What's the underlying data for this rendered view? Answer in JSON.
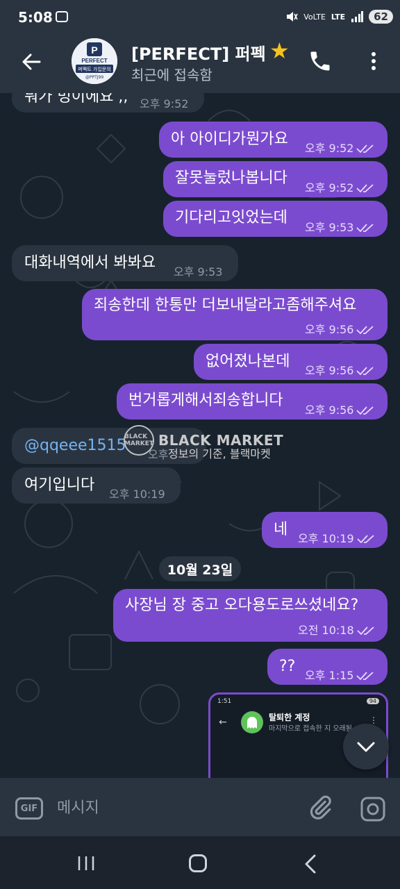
{
  "status_bar": {
    "time": "5:08",
    "battery": "62",
    "network": "LTE"
  },
  "header": {
    "title": "[PERFECT] 퍼펙",
    "subtitle": "최근에 접속함",
    "avatar_text": "PERFECT",
    "avatar_sub": "퍼펙트 가입문의",
    "avatar_handle": "@PPTJ99"
  },
  "messages": [
    {
      "dir": "in",
      "text": "뭐가 멍이에요 ,,",
      "time": "오후 9:52"
    },
    {
      "dir": "out",
      "text": "아 아이디가뭔가요",
      "time": "오후 9:52"
    },
    {
      "dir": "out",
      "text": "잘못눌렀나봅니다",
      "time": "오후 9:52"
    },
    {
      "dir": "out",
      "text": "기다리고잇었는데",
      "time": "오후 9:53"
    },
    {
      "dir": "in",
      "text": "대화내역에서 봐봐요",
      "time": "오후 9:53"
    },
    {
      "dir": "out",
      "text": "죄송한데 한통만 더보내달라고좀해주셔요",
      "time": "오후 9:56"
    },
    {
      "dir": "out",
      "text": "없어졌나본데",
      "time": "오후 9:56"
    },
    {
      "dir": "out",
      "text": "번거롭게해서죄송합니다",
      "time": "오후 9:56"
    },
    {
      "dir": "in",
      "text": "@qqeee1515",
      "time": "오후"
    },
    {
      "dir": "in",
      "text": "여기입니다",
      "time": "오후 10:19"
    },
    {
      "dir": "out",
      "text": "네",
      "time": "오후 10:19"
    },
    {
      "dir": "out",
      "text": "사장님 장 중고 오다용도로쓰셨네요?",
      "time": "오전 10:18"
    },
    {
      "dir": "out",
      "text": "??",
      "time": "오후 1:15"
    }
  ],
  "date_separator": "10월 23일",
  "watermark": {
    "logo": "BLACK MARKET",
    "title": "BLACK MARKET",
    "subtitle": "정보의 기준, 블랙마켓"
  },
  "preview": {
    "time": "1:51",
    "battery": "94",
    "title": "탈퇴한 계정",
    "subtitle": "마지막으로 접속한 지 오래됨"
  },
  "input": {
    "placeholder": "메시지",
    "gif_label": "GIF"
  },
  "colors": {
    "outgoing": "#7b4bcf",
    "incoming": "#2a3440",
    "background": "#18222d",
    "header": "#2a3440"
  }
}
